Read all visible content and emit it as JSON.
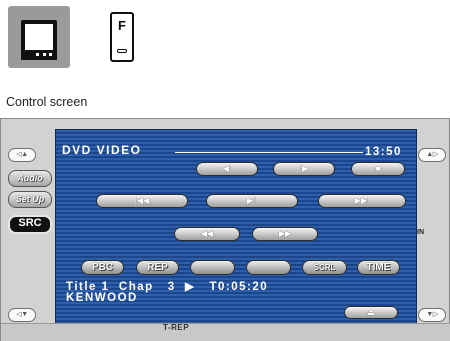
{
  "caption": "Control screen",
  "top_icons": {
    "f_label": "F"
  },
  "header": {
    "title": "DVD VIDEO",
    "clock": "13:50"
  },
  "left_edge": {
    "top_label": "◁▲",
    "bottom_label": "◁▼"
  },
  "right_edge": {
    "top_label": "▲▷",
    "bottom_label": "▼▷",
    "in_label": "IN"
  },
  "sidebar": {
    "audio": "Audio",
    "setup": "Set Up",
    "src": "SRC"
  },
  "transport": {
    "step_back": "◀|",
    "step_fwd": "|▶",
    "stop": "■",
    "prev": "|◀◀",
    "play_pause": "▶||",
    "next": "▶▶|",
    "rew": "◀◀",
    "ff": "▶▶"
  },
  "functions": {
    "pbc": "PBC",
    "rep": "REP",
    "scrl": "SCRL",
    "time": "TIME"
  },
  "status": {
    "line1": "Title 1  Chap   3  ▶   T0:05:20",
    "line2": "KENWOOD"
  },
  "eject_label": "⏏",
  "bottom_label": "T-REP"
}
